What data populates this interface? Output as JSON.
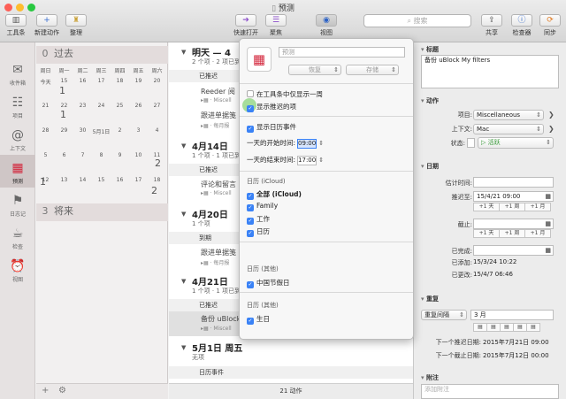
{
  "window": {
    "title": "预测",
    "traffic": {
      "close": "#fd5f57",
      "min": "#febc2e",
      "max": "#28c840"
    }
  },
  "toolbar": {
    "items": [
      {
        "label": "工具条",
        "icon": "sidebar-icon"
      },
      {
        "label": "新建动作",
        "icon": "plus-icon"
      },
      {
        "label": "整理",
        "icon": "broom-icon"
      },
      {
        "label": "快速打开",
        "icon": "arrow-icon"
      },
      {
        "label": "聚焦",
        "icon": "list-icon"
      },
      {
        "label": "视图",
        "icon": "eye-icon"
      },
      {
        "label": "共享",
        "icon": "share-icon"
      },
      {
        "label": "检查器",
        "icon": "info-icon"
      },
      {
        "label": "同步",
        "icon": "sync-icon"
      }
    ],
    "search_placeholder": "搜索"
  },
  "sidebar": {
    "items": [
      "收件箱",
      "项目",
      "上下文",
      "预测",
      "日志记",
      "检查",
      "视图"
    ]
  },
  "calendar": {
    "past": {
      "count": "0",
      "label": "过去"
    },
    "weekdays": [
      "周日",
      "周一",
      "周二",
      "周三",
      "周四",
      "周五",
      "周六"
    ],
    "day_row": [
      "今天",
      "15",
      "16",
      "17",
      "18",
      "19",
      "20"
    ],
    "weeks": [
      [
        "21",
        "22",
        "23",
        "24",
        "25",
        "26",
        "27"
      ],
      [
        "28",
        "29",
        "30",
        "5月1日",
        "2",
        "3",
        "4"
      ],
      [
        "5",
        "6",
        "7",
        "8",
        "9",
        "10",
        "11"
      ],
      [
        "12",
        "13",
        "14",
        "15",
        "16",
        "17",
        "18"
      ]
    ],
    "counts": [
      {
        "v": "1"
      },
      {
        "v": "1"
      },
      {
        "v": "2"
      },
      {
        "v": "1"
      },
      {
        "v": "2"
      }
    ],
    "future": {
      "count": "3",
      "label": "将来"
    }
  },
  "main": {
    "groups": [
      {
        "title": "明天 — 4",
        "sub": "2 个项 · 2 项已到"
      },
      {
        "title": "4月14日",
        "sub": "1 个项 · 1 项已到"
      },
      {
        "title": "4月20日",
        "sub": "1 个项"
      },
      {
        "title": "4月21日",
        "sub": "1 个项 · 1 项已到"
      },
      {
        "title": "5月1日 周五",
        "sub": "无项"
      }
    ],
    "sections": [
      "已推迟",
      "已推迟",
      "到期",
      "已推迟",
      "日历事件"
    ],
    "rows": [
      {
        "t": "Reeder 阅",
        "s": "▸▦ · Miscell"
      },
      {
        "t": "跟进单据笺",
        "s": "▸▦ · 每月报"
      },
      {
        "t": "评论和留言",
        "s": "▸▦ · Miscell"
      },
      {
        "t": "跟进单据笺",
        "s": "▸▦ · 每月报"
      },
      {
        "t": "备份 uBlock",
        "s": "▸▦ · Miscell"
      }
    ],
    "footer": "21 动作"
  },
  "popover": {
    "name_placeholder": "预测",
    "restore": "恢复",
    "save": "存储",
    "opt_week": "在工具条中仅显示一周",
    "opt_deferred": "显示推迟的项",
    "opt_events": "显示日历事件",
    "start_label": "一天的开始时间:",
    "start_value": "09:00",
    "end_label": "一天的结束时间:",
    "end_value": "17:00",
    "sec_icloud": "日历 (iCloud)",
    "cals_icloud": [
      "全部 (iCloud)",
      "Family",
      "工作",
      "日历"
    ],
    "sec_other1": "日历 (其他)",
    "cal_other1": "中国节假日",
    "sec_other2": "日历 (其他)",
    "cal_other2": "生日"
  },
  "inspector": {
    "title_h": "标题",
    "title_value": "备份 uBlock My filters",
    "action_h": "动作",
    "project_label": "项目:",
    "project_value": "Miscellaneous",
    "context_label": "上下文:",
    "context_value": "Mac",
    "status_label": "状态:",
    "status_value": "▷ 活跃",
    "date_h": "日期",
    "estimate_label": "估计时间:",
    "defer_label": "推迟至:",
    "defer_value": "15/4/21 09:00",
    "steps": [
      "+1 天",
      "+1 周",
      "+1 月",
      "+1 年"
    ],
    "due_label": "截止:",
    "completed_label": "已完成:",
    "added_label": "已添加:",
    "added_value": "15/3/24 10:22",
    "changed_label": "已更改:",
    "changed_value": "15/4/7 06:46",
    "repeat_h": "重复",
    "repeat_mode": "重复间隔",
    "repeat_value": "3 月",
    "next_defer_label": "下一个推迟日期:",
    "next_defer_value": "2015年7月21日 09:00",
    "next_due_label": "下一个截止日期:",
    "next_due_value": "2015年7月12日 00:00",
    "note_h": "附注",
    "note_placeholder": "添加附注"
  }
}
